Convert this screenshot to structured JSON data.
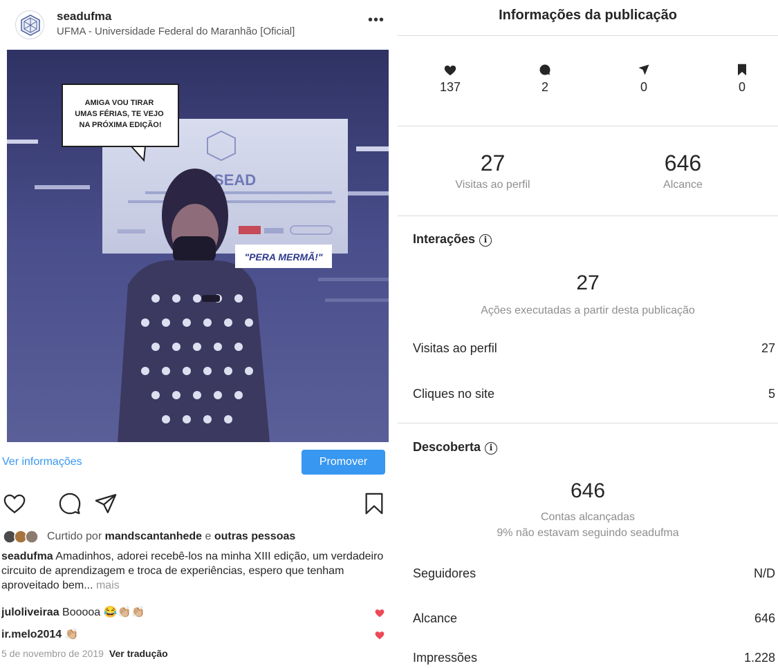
{
  "post": {
    "username": "seadufma",
    "location": "UFMA - Universidade Federal do Maranhão [Oficial]",
    "more_label": "•••",
    "image": {
      "speech_bubble": "AMIGA VOU TIRAR\nUMAS FÉRIAS, TE VEJO\nNA PRÓXIMA EDIÇÃO!",
      "screen_title": "XIII SEAD",
      "sticker": "\"PERA MERMÃ!\""
    },
    "ver_informacoes": "Ver informações",
    "promover": "Promover",
    "likes_prefix": "Curtido por ",
    "likes_user": "mandscantanhede",
    "likes_mid": " e ",
    "likes_suffix": "outras pessoas",
    "caption_user": "seadufma",
    "caption_text": " Amadinhos, adorei recebê-los na minha XIII edição, um verdadeiro circuito de aprendizagem e troca de experiências, espero que tenham aproveitado bem...",
    "caption_more": " mais",
    "comments": [
      {
        "user": "juloliveiraa",
        "text": " Booooa 😂👏🏼👏🏼"
      },
      {
        "user": "ir.melo2014",
        "text": " 👏🏼"
      }
    ],
    "date": "5 de novembro de 2019",
    "translate": "Ver tradução"
  },
  "insights": {
    "title": "Informações da publicação",
    "stats": [
      {
        "icon": "heart-icon",
        "value": "137"
      },
      {
        "icon": "comment-icon",
        "value": "2"
      },
      {
        "icon": "share-icon",
        "value": "0"
      },
      {
        "icon": "bookmark-icon",
        "value": "0"
      }
    ],
    "summary": [
      {
        "value": "27",
        "label": "Visitas ao perfil"
      },
      {
        "value": "646",
        "label": "Alcance"
      }
    ],
    "interactions": {
      "heading": "Interações",
      "info": "i",
      "total": "27",
      "total_label": "Ações executadas a partir desta publicação",
      "rows": [
        {
          "label": "Visitas ao perfil",
          "value": "27"
        },
        {
          "label": "Cliques no site",
          "value": "5"
        }
      ]
    },
    "discovery": {
      "heading": "Descoberta",
      "info": "i",
      "total": "646",
      "total_label": "Contas alcançadas",
      "sub_label": "9% não estavam seguindo seadufma",
      "rows": [
        {
          "label": "Seguidores",
          "value": "N/D"
        },
        {
          "label": "Alcance",
          "value": "646"
        },
        {
          "label": "Impressões",
          "value": "1.228"
        }
      ]
    }
  },
  "colors": {
    "link_blue": "#3897f0",
    "text": "#262626",
    "muted": "#8e8e8e",
    "like_red": "#ed4956"
  }
}
